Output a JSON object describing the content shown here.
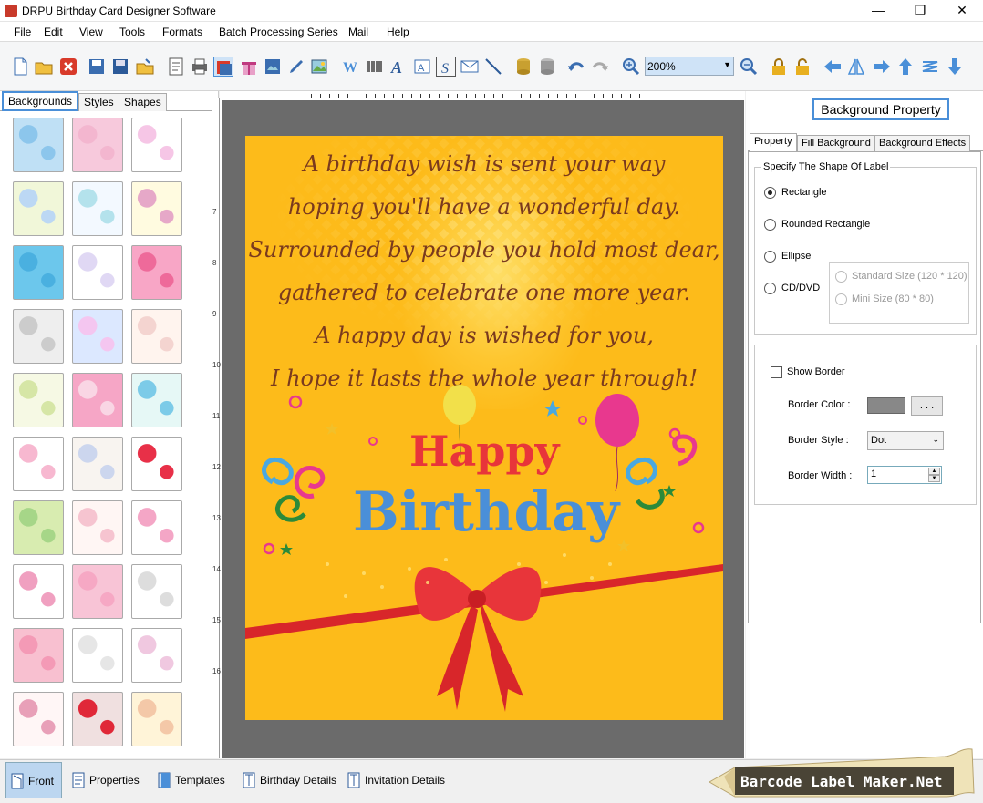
{
  "window": {
    "title": "DRPU Birthday Card Designer Software",
    "controls": [
      "minimize",
      "restore",
      "close"
    ]
  },
  "menu": [
    "File",
    "Edit",
    "View",
    "Tools",
    "Formats",
    "Batch Processing Series",
    "Mail",
    "Help"
  ],
  "toolbar": {
    "zoom": "200%",
    "icons": [
      "new-icon",
      "open-icon",
      "close-icon",
      "save-icon",
      "save-as-icon",
      "export-icon",
      "properties-icon",
      "print-icon",
      "card-view-icon",
      "gift-icon",
      "image-save-icon",
      "pen-icon",
      "picture-icon",
      "word-art-icon",
      "barcode-icon",
      "text-icon",
      "label-icon",
      "signature-icon",
      "envelope-icon",
      "line-icon",
      "database-icon",
      "database-grey-icon",
      "undo-icon",
      "redo-icon",
      "zoom-in-icon",
      "zoom-out-icon",
      "lock-icon",
      "unlock-icon",
      "arrow-left-icon",
      "flip-icon",
      "arrow-right-icon",
      "arrow-up-icon",
      "align-icon",
      "arrow-down-icon"
    ]
  },
  "left_tabs": [
    "Backgrounds",
    "Styles",
    "Shapes"
  ],
  "card": {
    "poem": [
      "A birthday wish is sent your way",
      "hoping you'll have a wonderful day.",
      "Surrounded by people you hold most dear,",
      "gathered to celebrate one more year.",
      "A happy day is wished for you,",
      "I hope it lasts the whole year through!"
    ],
    "happy": "Happy",
    "birthday": "Birthday"
  },
  "ruler": {
    "vertical_ticks": [
      "7",
      "8",
      "9",
      "10",
      "11",
      "12",
      "13",
      "14",
      "15",
      "16"
    ]
  },
  "right_panel": {
    "header": "Background Property",
    "tabs": [
      "Property",
      "Fill Background",
      "Background Effects"
    ],
    "shape_group_label": "Specify The Shape Of Label",
    "shapes": [
      "Rectangle",
      "Rounded Rectangle",
      "Ellipse",
      "CD/DVD"
    ],
    "selected_shape": "Rectangle",
    "cd_sizes": [
      "Standard Size (120 * 120)",
      "Mini Size (80 * 80)"
    ],
    "show_border_label": "Show Border",
    "border_color_label": "Border Color :",
    "border_color": "#8a8a8a",
    "border_color_button": ". . .",
    "border_style_label": "Border Style :",
    "border_style_value": "Dot",
    "border_width_label": "Border Width :",
    "border_width_value": "1"
  },
  "bottom_tabs": [
    "Front",
    "Properties",
    "Templates",
    "Birthday Details",
    "Invitation Details"
  ],
  "active_bottom_tab": "Front",
  "brand": "Barcode Label Maker.Net",
  "colors": {
    "card_background": "#fdbb1a",
    "poem_text": "#7a3a1e",
    "accent_blue": "#4a8fd8"
  }
}
